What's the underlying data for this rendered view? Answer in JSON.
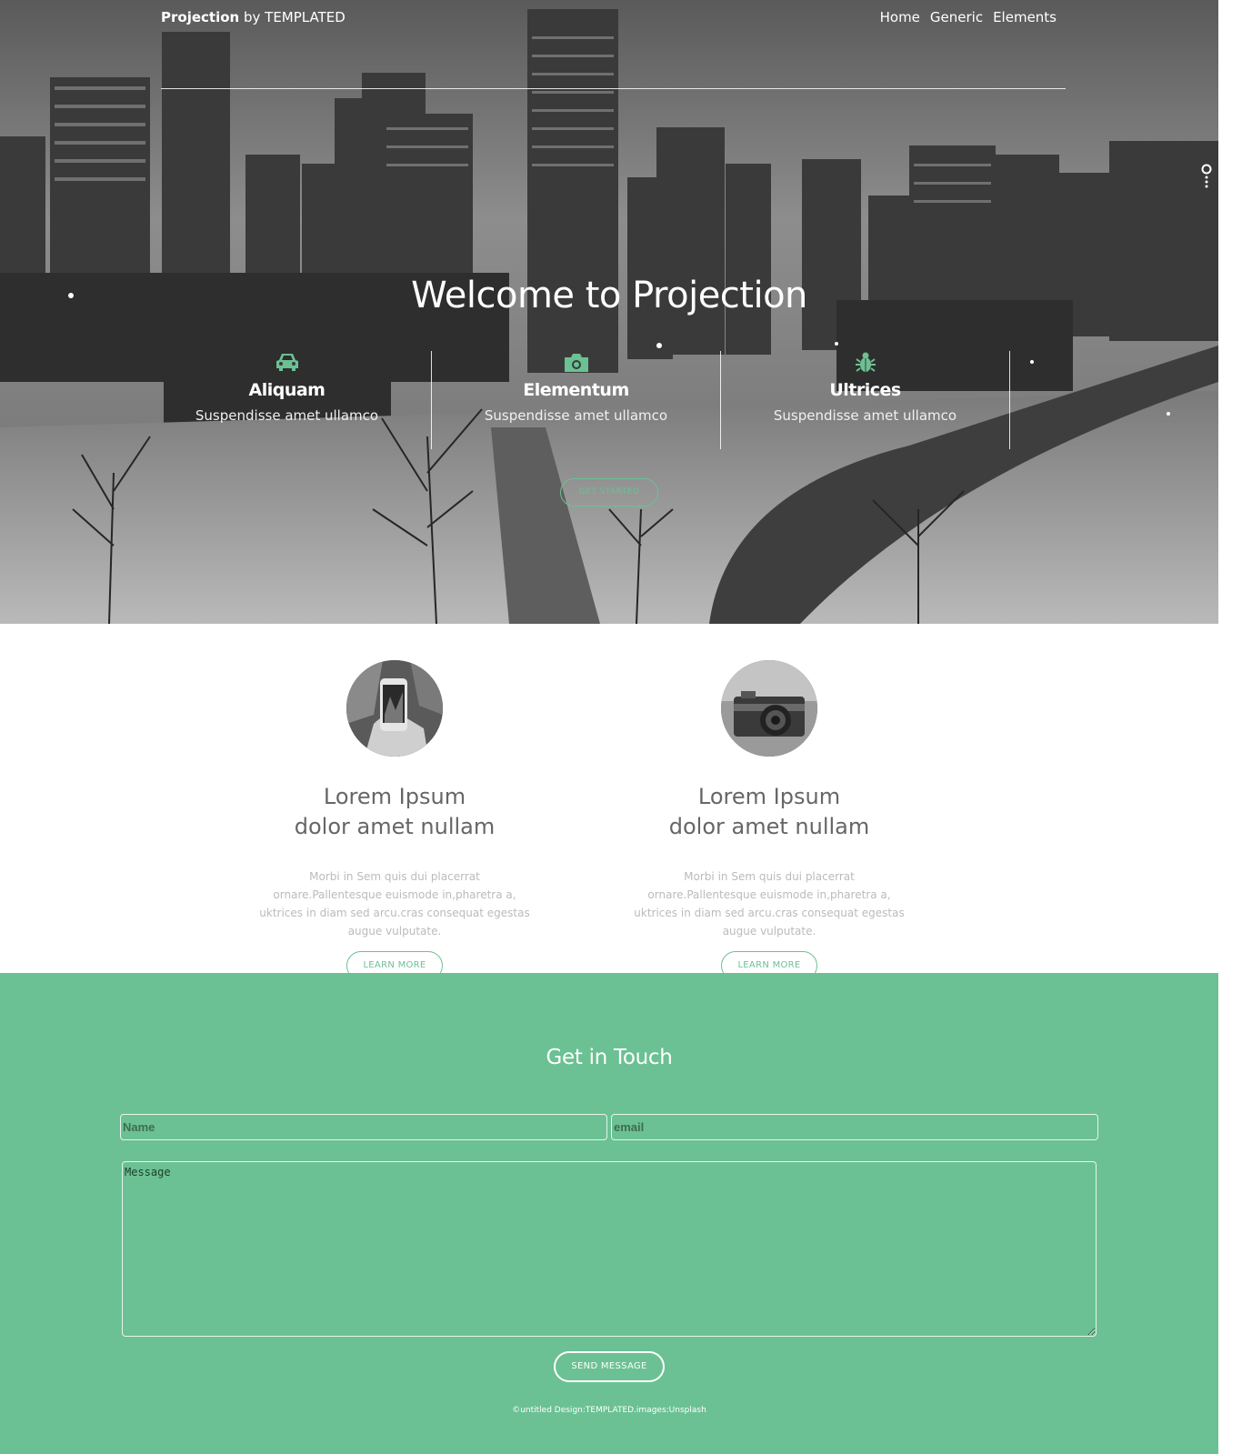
{
  "header": {
    "brand_bold": "Projection",
    "brand_rest": "by TEMPLATED",
    "nav": [
      "Home",
      "Generic",
      "Elements"
    ]
  },
  "hero": {
    "title": "Welcome to Projection",
    "features": [
      {
        "icon": "car-icon",
        "title": "Aliquam",
        "text": "Suspendisse amet ullamco"
      },
      {
        "icon": "camera-icon",
        "title": "Elementum",
        "text": "Suspendisse amet ullamco"
      },
      {
        "icon": "bug-icon",
        "title": "Ultrices",
        "text": "Suspendisse amet ullamco"
      }
    ],
    "cta_label": "GET STARTED"
  },
  "cards": [
    {
      "image": "phone-photo",
      "title_line1": "Lorem Ipsum",
      "title_line2": "dolor amet nullam",
      "body": "Morbi in Sem quis dui placerrat ornare.Pallentesque euismode in,pharetra a, uktrices in diam sed arcu.cras consequat egestas augue vulputate.",
      "button": "LEARN MORE"
    },
    {
      "image": "camera-photo",
      "title_line1": "Lorem Ipsum",
      "title_line2": "dolor amet nullam",
      "body": "Morbi in Sem quis dui placerrat ornare.Pallentesque euismode in,pharetra a, uktrices in diam sed arcu.cras consequat egestas augue vulputate.",
      "button": "LEARN MORE"
    }
  ],
  "contact": {
    "title": "Get in Touch",
    "name_placeholder": "Name",
    "email_placeholder": "email",
    "message_placeholder": "Message",
    "send_label": "SEND MESSAGE"
  },
  "footer": {
    "text": "©untitled Design:TEMPLATED.images:Unsplash"
  },
  "colors": {
    "accent": "#6bc193",
    "white": "#ffffff"
  }
}
